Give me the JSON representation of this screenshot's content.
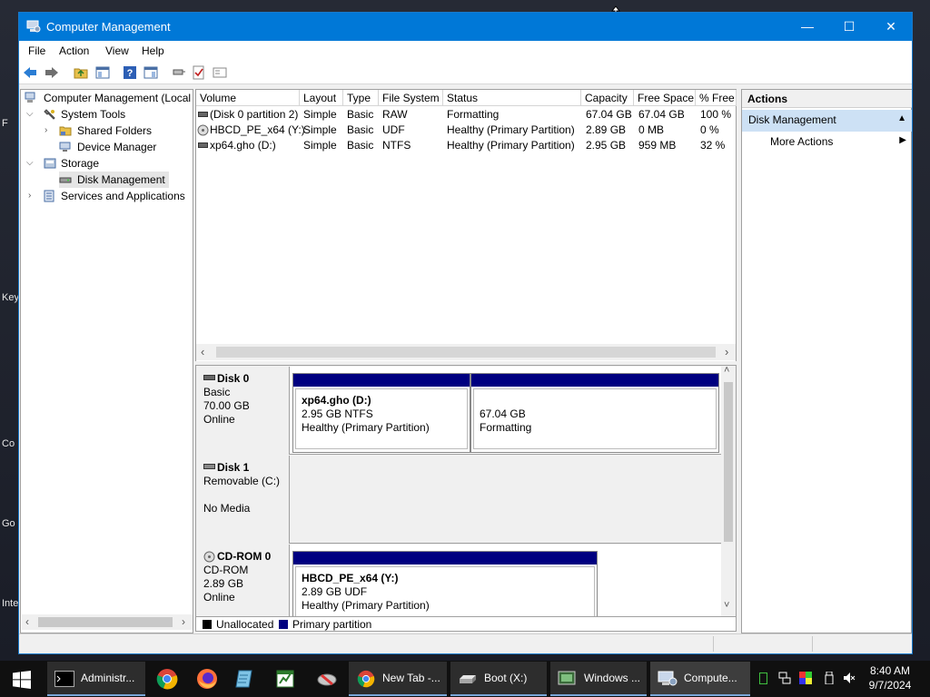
{
  "desktop": {
    "labels": [
      "F",
      "Key",
      "Co",
      "Go",
      "Inte"
    ]
  },
  "window": {
    "title": "Computer Management",
    "minimize": "—",
    "maximize": "☐",
    "close": "✕"
  },
  "menu": [
    "File",
    "Action",
    "View",
    "Help"
  ],
  "tree": {
    "root": "Computer Management (Local",
    "system_tools": "System Tools",
    "shared_folders": "Shared Folders",
    "device_manager": "Device Manager",
    "storage": "Storage",
    "disk_management": "Disk Management",
    "services": "Services and Applications"
  },
  "volumes": {
    "columns": [
      "Volume",
      "Layout",
      "Type",
      "File System",
      "Status",
      "Capacity",
      "Free Space",
      "% Free"
    ],
    "rows": [
      {
        "volume": "(Disk 0 partition 2)",
        "layout": "Simple",
        "type": "Basic",
        "fs": "RAW",
        "status": "Formatting",
        "capacity": "67.04 GB",
        "free": "67.04 GB",
        "pct": "100 %"
      },
      {
        "volume": "HBCD_PE_x64 (Y:)",
        "layout": "Simple",
        "type": "Basic",
        "fs": "UDF",
        "status": "Healthy (Primary Partition)",
        "capacity": "2.89 GB",
        "free": "0 MB",
        "pct": "0 %"
      },
      {
        "volume": "xp64.gho (D:)",
        "layout": "Simple",
        "type": "Basic",
        "fs": "NTFS",
        "status": "Healthy (Primary Partition)",
        "capacity": "2.95 GB",
        "free": "959 MB",
        "pct": "32 %"
      }
    ]
  },
  "disks": [
    {
      "name": "Disk 0",
      "type": "Basic",
      "size": "70.00 GB",
      "state": "Online",
      "parts": [
        {
          "title": "xp64.gho  (D:)",
          "line1": "2.95 GB NTFS",
          "line2": "Healthy (Primary Partition)"
        },
        {
          "title": "",
          "line1": "67.04 GB",
          "line2": "Formatting"
        }
      ]
    },
    {
      "name": "Disk 1",
      "type": "Removable (C:)",
      "size": "",
      "state": "No Media",
      "parts": []
    },
    {
      "name": "CD-ROM 0",
      "type": "CD-ROM",
      "size": "2.89 GB",
      "state": "Online",
      "parts": [
        {
          "title": "HBCD_PE_x64  (Y:)",
          "line1": "2.89 GB UDF",
          "line2": "Healthy (Primary Partition)"
        }
      ]
    }
  ],
  "legend": {
    "unallocated": "Unallocated",
    "primary": "Primary partition",
    "unallocated_color": "#000000",
    "primary_color": "#000080"
  },
  "actions": {
    "header": "Actions",
    "section": "Disk Management",
    "more": "More Actions"
  },
  "taskbar": {
    "buttons": [
      "Administr...",
      "New Tab -...",
      "Boot (X:)",
      "Windows ...",
      "Compute..."
    ],
    "time": "8:40 AM",
    "date": "9/7/2024"
  },
  "colors": {
    "titlebar": "#0078d7",
    "selection": "#cce8ff",
    "section": "#cde1f5"
  }
}
